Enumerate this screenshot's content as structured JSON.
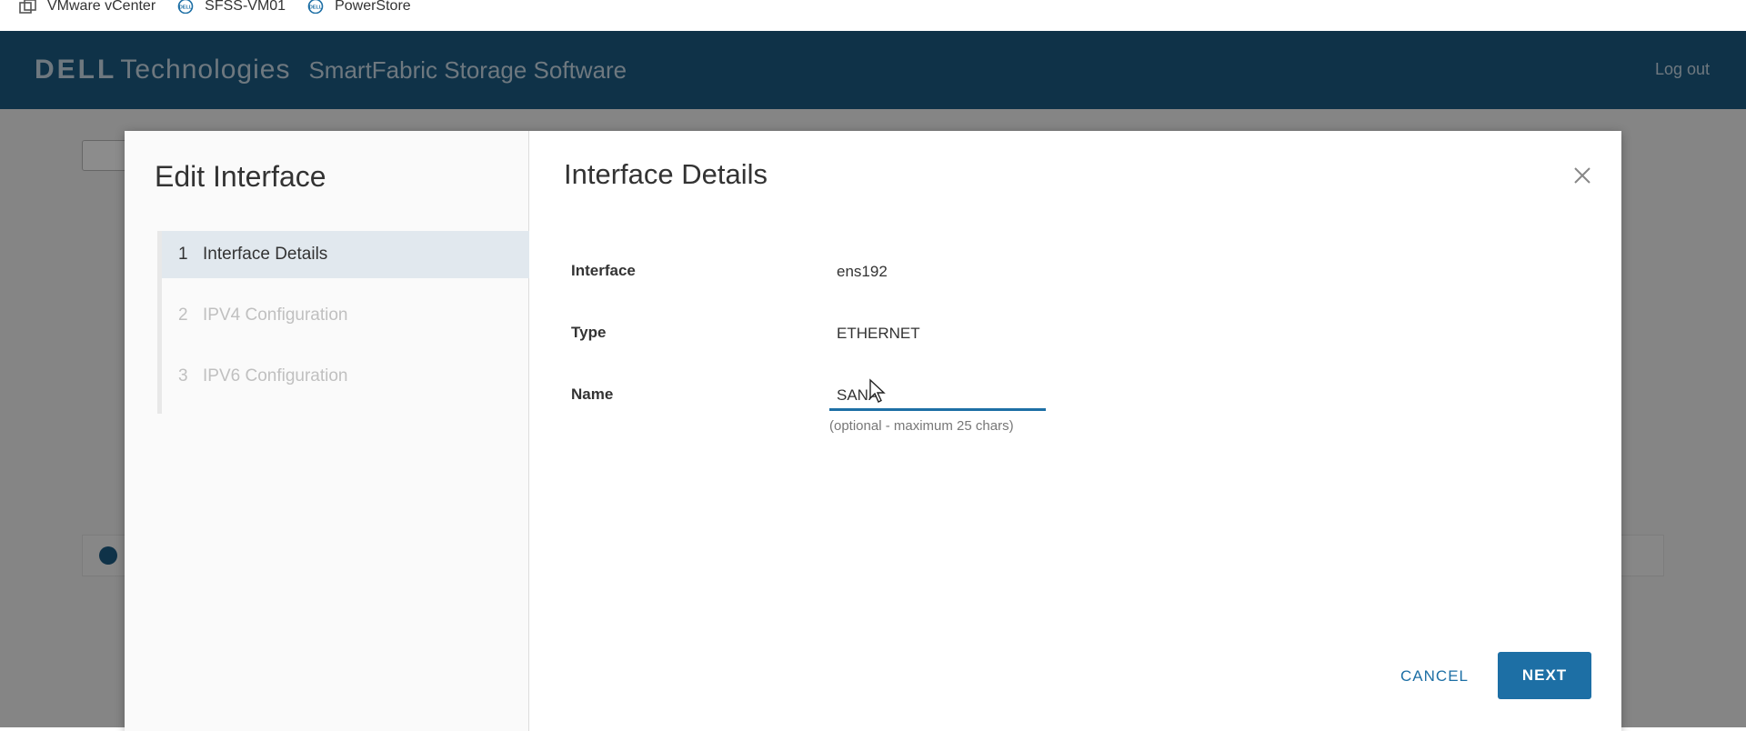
{
  "bookmarks": [
    {
      "label": "VMware vCenter",
      "icon": "vcenter-icon"
    },
    {
      "label": "SFSS-VM01",
      "icon": "dell-icon"
    },
    {
      "label": "PowerStore",
      "icon": "dell-icon"
    }
  ],
  "app": {
    "brand_dell": "DELL",
    "brand_tech": "Technologies",
    "product": "SmartFabric Storage Software",
    "logout": "Log out"
  },
  "modal": {
    "title": "Edit Interface",
    "steps": [
      {
        "num": "1",
        "label": "Interface Details",
        "active": true
      },
      {
        "num": "2",
        "label": "IPV4 Configuration",
        "active": false
      },
      {
        "num": "3",
        "label": "IPV6 Configuration",
        "active": false
      }
    ],
    "section_title": "Interface Details",
    "fields": {
      "interface_label": "Interface",
      "interface_value": "ens192",
      "type_label": "Type",
      "type_value": "ETHERNET",
      "name_label": "Name",
      "name_value": "SANA",
      "name_hint": "(optional - maximum 25 chars)"
    },
    "cancel_label": "CANCEL",
    "next_label": "NEXT"
  },
  "colors": {
    "header": "#1d5b84",
    "accent": "#1d6fa5",
    "step_active_bg": "#e1e8ee"
  }
}
